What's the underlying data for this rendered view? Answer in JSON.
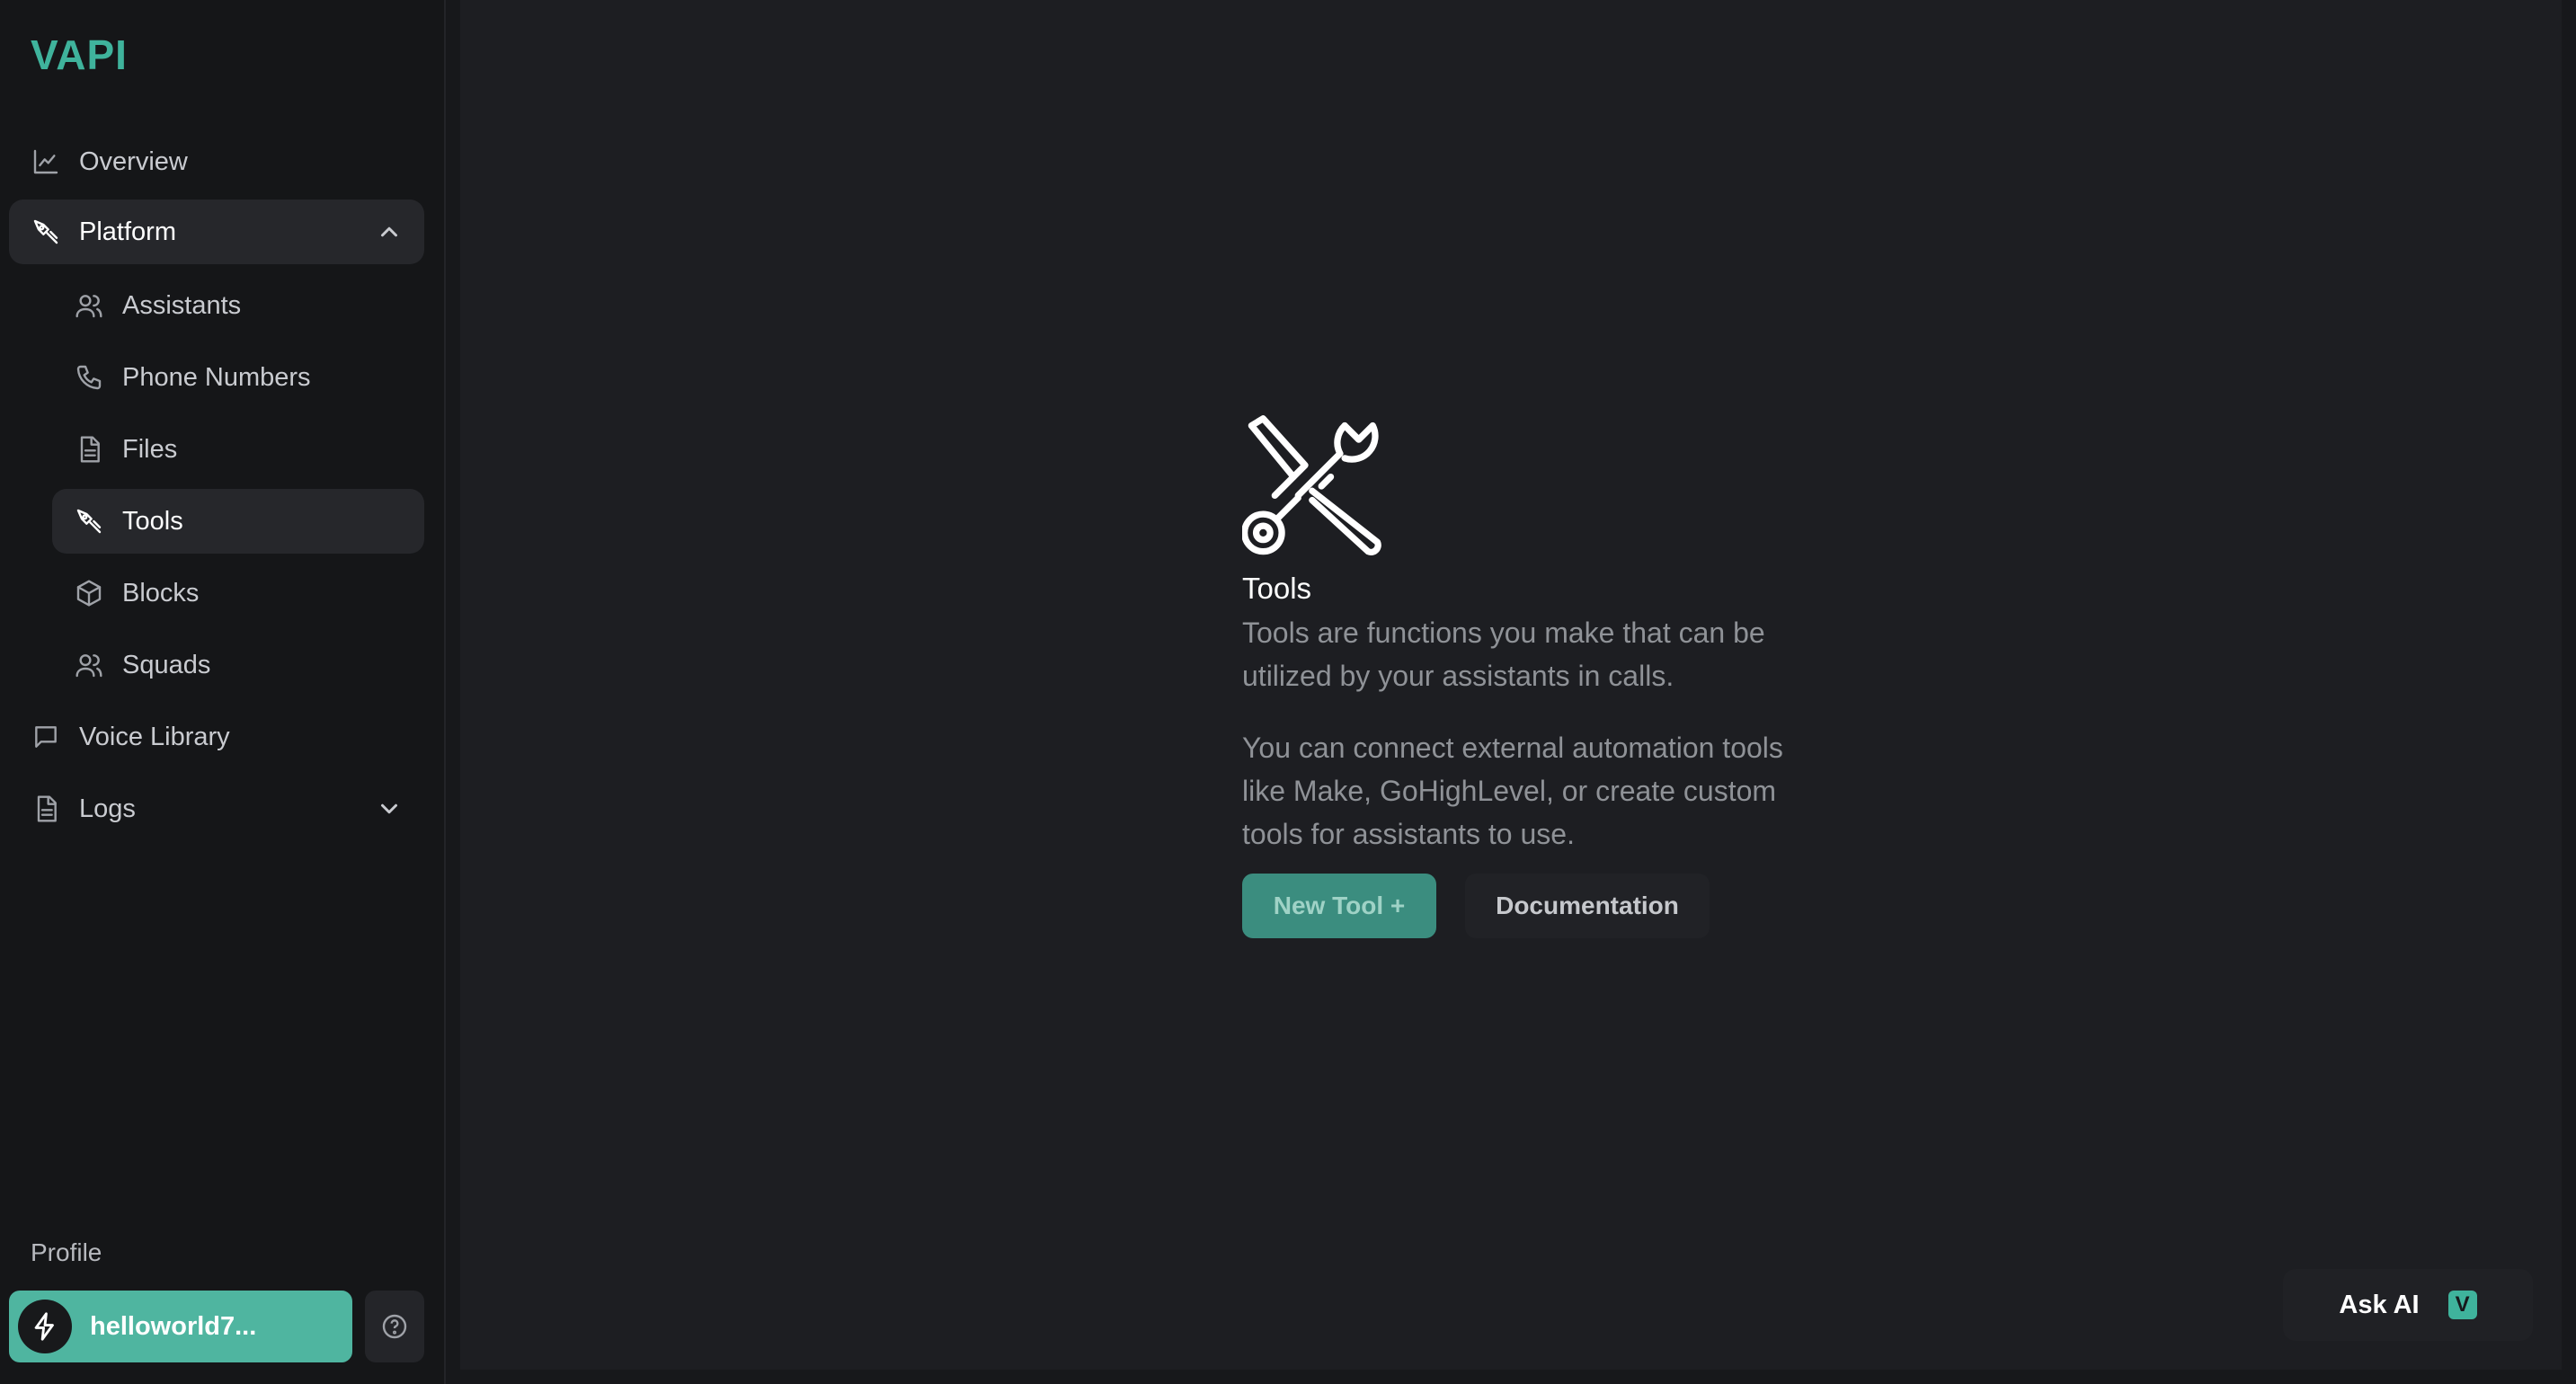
{
  "brand": {
    "logo_text": "VAPI",
    "accent_color": "#3fb39c"
  },
  "sidebar": {
    "overview": {
      "label": "Overview",
      "icon": "line-chart-icon"
    },
    "platform": {
      "label": "Platform",
      "icon": "tools-icon",
      "expanded": true
    },
    "platform_items": [
      {
        "label": "Assistants",
        "icon": "users-icon"
      },
      {
        "label": "Phone Numbers",
        "icon": "phone-icon"
      },
      {
        "label": "Files",
        "icon": "file-icon"
      },
      {
        "label": "Tools",
        "icon": "tools-icon",
        "active": true
      },
      {
        "label": "Blocks",
        "icon": "cube-icon"
      },
      {
        "label": "Squads",
        "icon": "users-icon"
      }
    ],
    "voice_library": {
      "label": "Voice Library",
      "icon": "message-square-icon"
    },
    "logs": {
      "label": "Logs",
      "icon": "file-icon",
      "expanded": false
    },
    "profile": {
      "section_label": "Profile",
      "name": "helloworld7...",
      "avatar_icon": "bolt-icon",
      "help_icon": "help-circle-icon"
    }
  },
  "main": {
    "empty_state": {
      "icon": "wrench-screwdriver-icon",
      "title": "Tools",
      "description": "Tools are functions you make that can be utilized by your assistants in calls.",
      "description_2": "You can connect external automation tools like Make, GoHighLevel, or create custom tools for assistants to use.",
      "primary_button": "New Tool +",
      "secondary_button": "Documentation"
    },
    "ask_ai": {
      "label": "Ask AI",
      "badge": "V"
    }
  }
}
